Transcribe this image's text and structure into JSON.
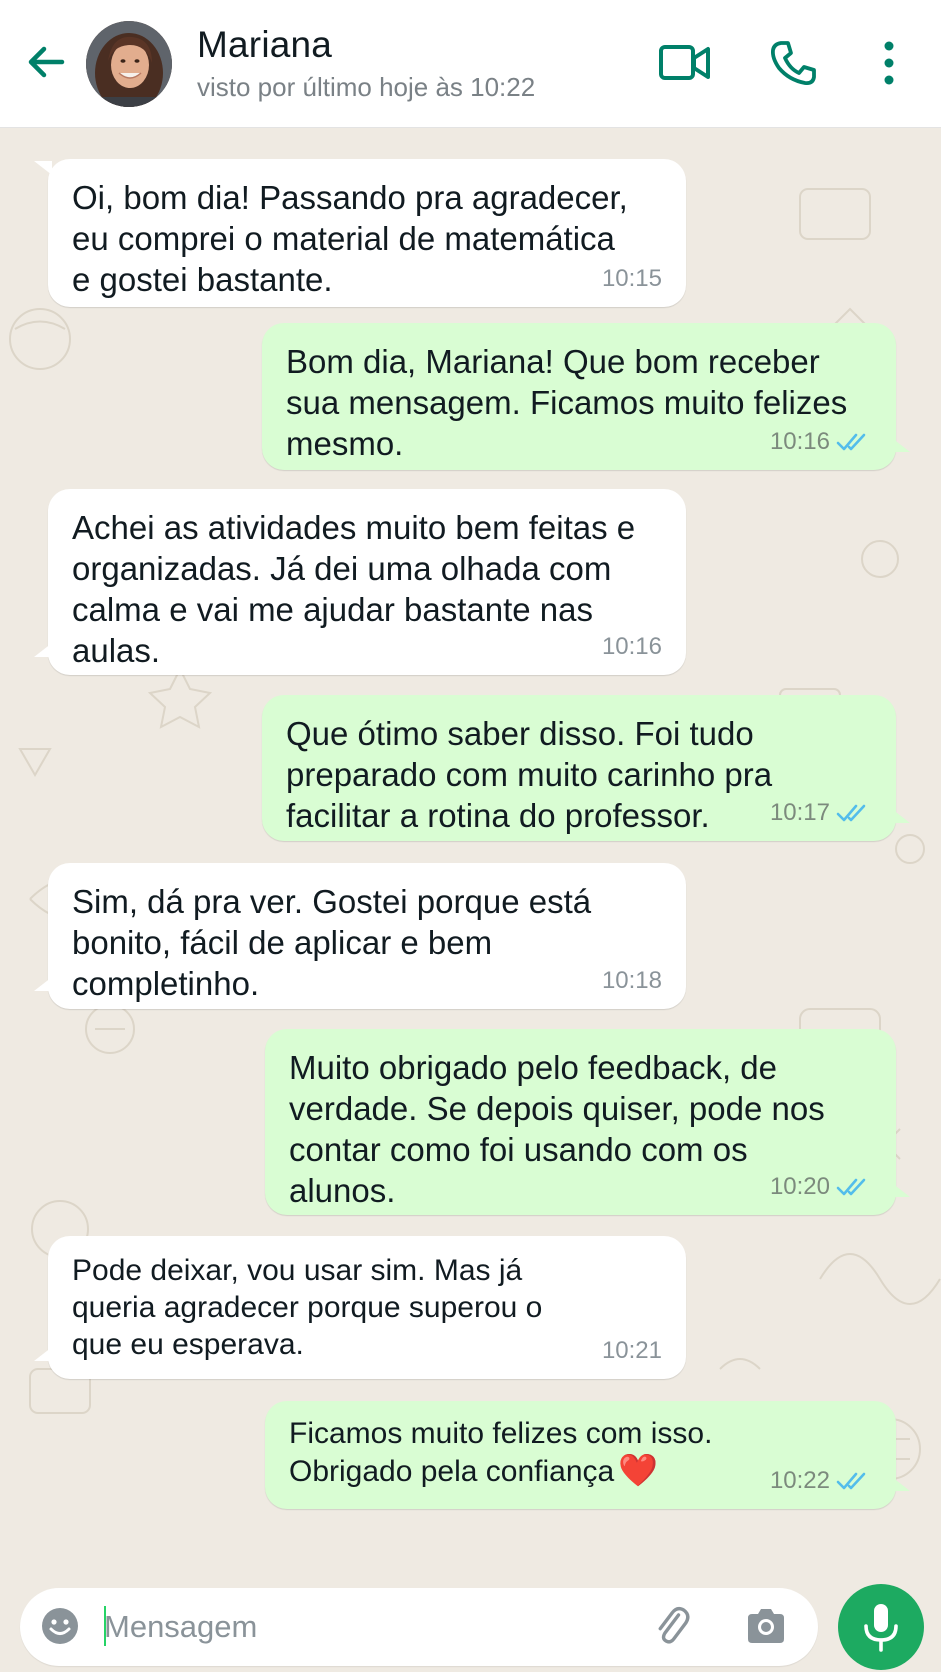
{
  "header": {
    "contact_name": "Mariana",
    "status": "visto por último hoje às 10:22"
  },
  "colors": {
    "accent": "#008069",
    "chat_background": "#efeae2",
    "incoming_bubble": "#ffffff",
    "outgoing_bubble": "#d9fdd3",
    "read_ticks": "#53bdeb",
    "mic_button": "#1daa61"
  },
  "messages": [
    {
      "direction": "in",
      "text": "Oi, bom dia! Passando pra agradecer,\neu comprei o material de matemática\ne gostei bastante.",
      "time": "10:15"
    },
    {
      "direction": "out",
      "text": "Bom dia, Mariana! Que bom receber\nsua mensagem. Ficamos muito felizes\nmesmo.",
      "time": "10:16",
      "status": "read"
    },
    {
      "direction": "in",
      "text": "Achei as atividades muito bem feitas e\norganizadas. Já dei uma olhada com\ncalma e vai me ajudar bastante nas\naulas.",
      "time": "10:16"
    },
    {
      "direction": "out",
      "text": "Que ótimo saber disso. Foi tudo\npreparado com muito carinho pra\nfacilitar a rotina do professor.",
      "time": "10:17",
      "status": "read"
    },
    {
      "direction": "in",
      "text": "Sim, dá pra ver. Gostei porque está\nbonito, fácil de aplicar e bem\ncompletinho.",
      "time": "10:18"
    },
    {
      "direction": "out",
      "text": "Muito obrigado pelo feedback, de\nverdade. Se depois quiser, pode nos\ncontar como foi usando com os\nalunos.",
      "time": "10:20",
      "status": "read"
    },
    {
      "direction": "in",
      "text": "Pode deixar, vou usar sim. Mas já\nqueria agradecer porque superou o\nque eu esperava.",
      "time": "10:21"
    },
    {
      "direction": "out",
      "text": "Ficamos muito felizes com isso.\nObrigado pela confiança",
      "emoji": "❤️",
      "time": "10:22",
      "status": "read"
    }
  ],
  "composer": {
    "placeholder": "Mensagem"
  },
  "icons": {
    "back": "arrow-left-icon",
    "video": "video-camera-icon",
    "call": "phone-icon",
    "menu": "more-vertical-icon",
    "emoji": "smiley-icon",
    "attach": "paperclip-icon",
    "camera": "camera-icon",
    "mic": "microphone-icon",
    "read": "double-check-icon"
  }
}
